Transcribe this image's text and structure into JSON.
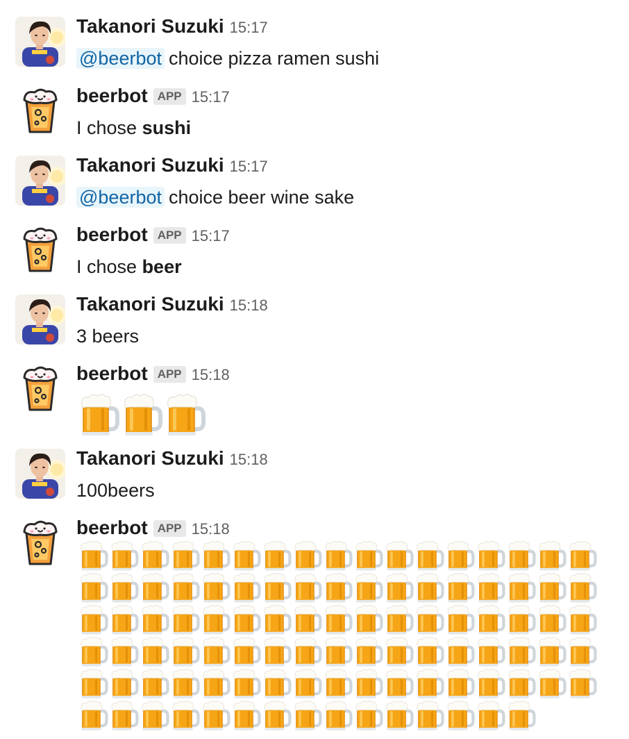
{
  "messages": [
    {
      "sender": "Takanori Suzuki",
      "time": "15:17",
      "is_app": false,
      "mention": "@beerbot",
      "text": "choice pizza ramen sushi"
    },
    {
      "sender": "beerbot",
      "app_badge": "APP",
      "time": "15:17",
      "is_app": true,
      "text_prefix": "I chose ",
      "text_bold": "sushi"
    },
    {
      "sender": "Takanori Suzuki",
      "time": "15:17",
      "is_app": false,
      "mention": "@beerbot",
      "text": "choice beer wine sake"
    },
    {
      "sender": "beerbot",
      "app_badge": "APP",
      "time": "15:17",
      "is_app": true,
      "text_prefix": "I chose ",
      "text_bold": "beer"
    },
    {
      "sender": "Takanori Suzuki",
      "time": "15:18",
      "is_app": false,
      "text": "3 beers"
    },
    {
      "sender": "beerbot",
      "app_badge": "APP",
      "time": "15:18",
      "is_app": true,
      "emoji": "beer-mug-icon",
      "emoji_count": 3
    },
    {
      "sender": "Takanori Suzuki",
      "time": "15:18",
      "is_app": false,
      "text": "100beers"
    },
    {
      "sender": "beerbot",
      "app_badge": "APP",
      "time": "15:18",
      "is_app": true,
      "emoji": "beer-mug-icon",
      "emoji_count": 100
    }
  ],
  "colors": {
    "mention_bg": "#e8f5fa",
    "mention_text": "#1264a3",
    "timestamp": "#616061",
    "badge_bg": "#e8e8e8"
  }
}
